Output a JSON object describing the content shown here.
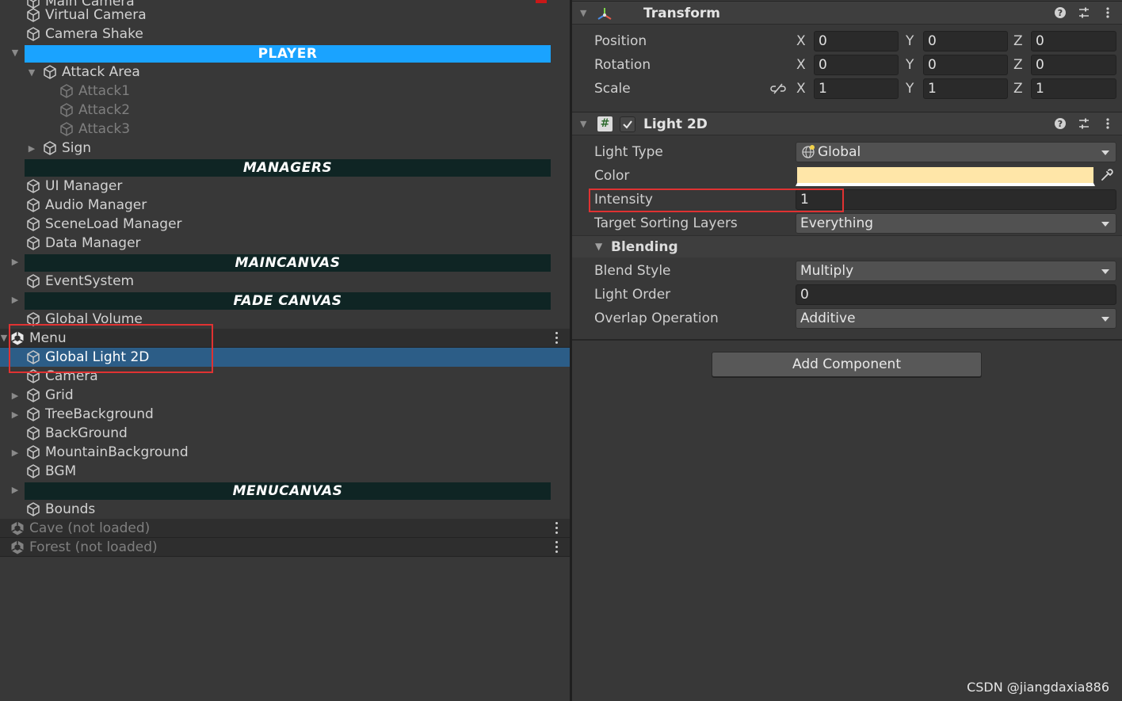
{
  "hierarchy": {
    "top_partial": "Main Camera",
    "items": {
      "virtual_camera": "Virtual Camera",
      "camera_shake": "Camera Shake",
      "attack_area": "Attack Area",
      "attack1": "Attack1",
      "attack2": "Attack2",
      "attack3": "Attack3",
      "sign": "Sign",
      "ui_manager": "UI Manager",
      "audio_manager": "Audio Manager",
      "sceneload_manager": "SceneLoad Manager",
      "data_manager": "Data Manager",
      "event_system": "EventSystem",
      "global_volume": "Global Volume",
      "global_light_2d": "Global Light 2D",
      "camera": "Camera",
      "grid": "Grid",
      "tree_background": "TreeBackground",
      "background": "BackGround",
      "mountain_background": "MountainBackground",
      "bgm": "BGM",
      "bounds": "Bounds"
    },
    "headers": {
      "player": "PLAYER",
      "managers": "MANAGERS",
      "maincanvas": "MAINCANVAS",
      "fade_canvas": "FADE CANVAS",
      "menucanvas": "MENUCANVAS"
    },
    "scenes": {
      "menu": "Menu",
      "cave": "Cave (not loaded)",
      "forest": "Forest (not loaded)"
    }
  },
  "inspector": {
    "transform": {
      "title": "Transform",
      "position_label": "Position",
      "rotation_label": "Rotation",
      "scale_label": "Scale",
      "axis_x": "X",
      "axis_y": "Y",
      "axis_z": "Z",
      "position": {
        "x": "0",
        "y": "0",
        "z": "0"
      },
      "rotation": {
        "x": "0",
        "y": "0",
        "z": "0"
      },
      "scale": {
        "x": "1",
        "y": "1",
        "z": "1"
      }
    },
    "light2d": {
      "title": "Light 2D",
      "light_type_label": "Light Type",
      "light_type_value": "Global",
      "color_label": "Color",
      "color_value": "#ffe6a8",
      "intensity_label": "Intensity",
      "intensity_value": "1",
      "target_sorting_layers_label": "Target Sorting Layers",
      "target_sorting_layers_value": "Everything",
      "blending_label": "Blending",
      "blend_style_label": "Blend Style",
      "blend_style_value": "Multiply",
      "light_order_label": "Light Order",
      "light_order_value": "0",
      "overlap_operation_label": "Overlap Operation",
      "overlap_operation_value": "Additive"
    },
    "add_component_label": "Add Component"
  },
  "watermark": "CSDN @jiangdaxia886",
  "colors": {
    "selection": "#2c5d87",
    "player_header": "#1aa3ff",
    "dark_header": "#0f2524",
    "highlight_box": "#e03232"
  }
}
